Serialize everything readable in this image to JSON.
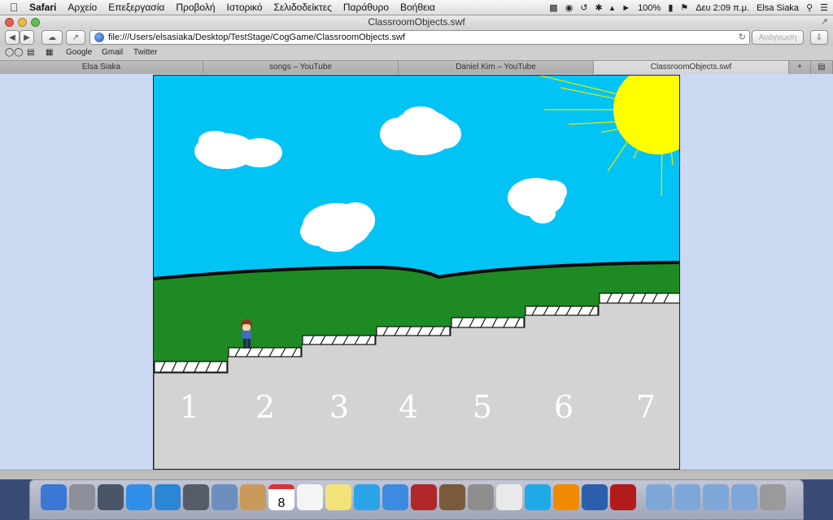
{
  "menubar": {
    "app": "Safari",
    "items": [
      "Αρχείο",
      "Επεξεργασία",
      "Προβολή",
      "Ιστορικό",
      "Σελιδοδείκτες",
      "Παράθυρο",
      "Βοήθεια"
    ],
    "battery": "100%",
    "clock": "Δευ 2:09 π.μ.",
    "user": "Elsa Siaka"
  },
  "window": {
    "title": "ClassroomObjects.swf",
    "url": "file:///Users/elsasiaka/Desktop/TestStage/CogGame/ClassroomObjects.swf",
    "reader_label": "Ανάγνωση"
  },
  "bookmarks": [
    "Google",
    "Gmail",
    "Twitter"
  ],
  "tabs": [
    {
      "label": "Elsa Siaka"
    },
    {
      "label": "songs – YouTube"
    },
    {
      "label": "Daniel Kim – YouTube"
    },
    {
      "label": "ClassroomObjects.swf"
    }
  ],
  "game": {
    "steps": [
      "1",
      "2",
      "3",
      "4",
      "5",
      "6",
      "7"
    ],
    "colors": {
      "sky": "#02c4f4",
      "grass": "#1d8a24",
      "road": "#d3d3d3",
      "sun": "#ffff00"
    }
  },
  "dock": {
    "icons": [
      "finder-icon",
      "launchpad-icon",
      "mission-control-icon",
      "app-store-icon",
      "safari-icon",
      "facetime-icon",
      "mail-icon",
      "contacts-icon",
      "calendar-icon",
      "reminders-icon",
      "notes-icon",
      "twitter-icon",
      "itunes-icon",
      "photo-booth-icon",
      "iphoto-icon",
      "system-preferences-icon",
      "chrome-icon",
      "skype-icon",
      "vlc-icon",
      "word-icon",
      "flash-icon",
      "applications-folder-icon",
      "utilities-folder-icon",
      "documents-folder-icon",
      "downloads-folder-icon",
      "trash-icon"
    ],
    "calendar_day": "8"
  }
}
